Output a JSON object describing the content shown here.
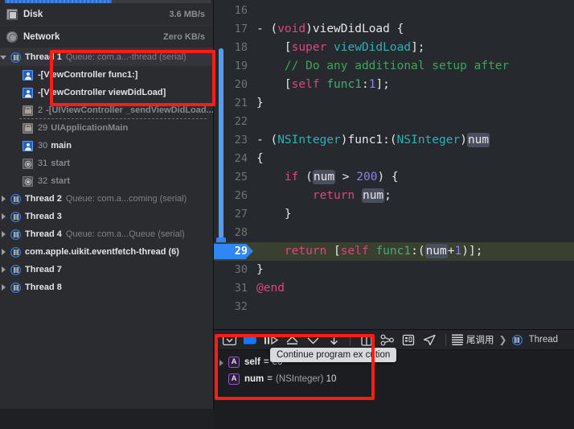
{
  "navigator": {
    "gauges": [
      {
        "icon": "disk-icon",
        "label": "Disk",
        "value": "3.6 MB/s"
      },
      {
        "icon": "network-icon",
        "label": "Network",
        "value": "Zero KB/s"
      }
    ],
    "threads": [
      {
        "icon": "thread-icon",
        "name": "Thread 1",
        "queue": "Queue: com.a...-thread (serial)",
        "expanded": true,
        "selected": true,
        "frames": [
          {
            "icon": "person-icon",
            "num": "",
            "text": "-[ViewController func1:]",
            "style": "bold"
          },
          {
            "icon": "person-icon",
            "num": "",
            "text": "-[ViewController viewDidLoad]",
            "style": "bold"
          },
          {
            "icon": "case-icon",
            "num": "2",
            "text": "-[UIViewController _sendViewDidLoad...",
            "style": "dim"
          },
          {
            "icon": "case-icon",
            "num": "29",
            "text": "UIApplicationMain",
            "style": "dim"
          },
          {
            "icon": "person-icon",
            "num": "30",
            "text": "main",
            "style": "bold"
          },
          {
            "icon": "gear-icon",
            "num": "31",
            "text": "start",
            "style": "dim"
          },
          {
            "icon": "gear-icon",
            "num": "32",
            "text": "start",
            "style": "dim"
          }
        ]
      },
      {
        "icon": "thread-icon",
        "name": "Thread 2",
        "queue": "Queue: com.a...coming (serial)",
        "expanded": false,
        "frames": []
      },
      {
        "icon": "thread-icon",
        "name": "Thread 3",
        "queue": "",
        "expanded": false,
        "frames": []
      },
      {
        "icon": "thread-icon",
        "name": "Thread 4",
        "queue": "Queue: com.a...Queue (serial)",
        "expanded": false,
        "frames": []
      },
      {
        "icon": "thread-icon",
        "name": "com.apple.uikit.eventfetch-thread (6)",
        "queue": "",
        "expanded": false,
        "frames": []
      },
      {
        "icon": "thread-icon",
        "name": "Thread 7",
        "queue": "",
        "expanded": false,
        "frames": []
      },
      {
        "icon": "thread-icon",
        "name": "Thread 8",
        "queue": "",
        "expanded": false,
        "frames": []
      }
    ]
  },
  "editor": {
    "first_line": 16,
    "current_line": 29,
    "lines": [
      {
        "n": "16",
        "tokens": []
      },
      {
        "n": "17",
        "tokens": [
          {
            "t": "- ",
            "c": "plain"
          },
          {
            "t": "(",
            "c": "plain"
          },
          {
            "t": "void",
            "c": "kw"
          },
          {
            "t": ")",
            "c": "plain"
          },
          {
            "t": "viewDidLoad",
            "c": "plain"
          },
          {
            "t": " {",
            "c": "plain"
          }
        ]
      },
      {
        "n": "18",
        "tokens": [
          {
            "t": "    [",
            "c": "plain"
          },
          {
            "t": "super",
            "c": "kw"
          },
          {
            "t": " ",
            "c": "plain"
          },
          {
            "t": "viewDidLoad",
            "c": "type"
          },
          {
            "t": "];",
            "c": "plain"
          }
        ]
      },
      {
        "n": "19",
        "tokens": [
          {
            "t": "    // Do any additional setup after",
            "c": "cmt"
          }
        ]
      },
      {
        "n": "20",
        "tokens": [
          {
            "t": "    [",
            "c": "plain"
          },
          {
            "t": "self",
            "c": "kw"
          },
          {
            "t": " ",
            "c": "plain"
          },
          {
            "t": "func1",
            "c": "fn"
          },
          {
            "t": ":",
            "c": "plain"
          },
          {
            "t": "1",
            "c": "num"
          },
          {
            "t": "];",
            "c": "plain"
          }
        ]
      },
      {
        "n": "21",
        "tokens": [
          {
            "t": "}",
            "c": "plain"
          }
        ]
      },
      {
        "n": "22",
        "tokens": []
      },
      {
        "n": "23",
        "tokens": [
          {
            "t": "- ",
            "c": "plain"
          },
          {
            "t": "(",
            "c": "plain"
          },
          {
            "t": "NSInteger",
            "c": "type"
          },
          {
            "t": ")",
            "c": "plain"
          },
          {
            "t": "func1",
            "c": "plain"
          },
          {
            "t": ":(",
            "c": "plain"
          },
          {
            "t": "NSInteger",
            "c": "type"
          },
          {
            "t": ")",
            "c": "plain"
          },
          {
            "t": "num",
            "c": "varhl"
          }
        ]
      },
      {
        "n": "24",
        "tokens": [
          {
            "t": "{",
            "c": "plain"
          }
        ]
      },
      {
        "n": "25",
        "tokens": [
          {
            "t": "    ",
            "c": "plain"
          },
          {
            "t": "if",
            "c": "kw"
          },
          {
            "t": " (",
            "c": "plain"
          },
          {
            "t": "num",
            "c": "varhl"
          },
          {
            "t": " > ",
            "c": "plain"
          },
          {
            "t": "200",
            "c": "num"
          },
          {
            "t": ") {",
            "c": "plain"
          }
        ]
      },
      {
        "n": "26",
        "tokens": [
          {
            "t": "        ",
            "c": "plain"
          },
          {
            "t": "return",
            "c": "kw"
          },
          {
            "t": " ",
            "c": "plain"
          },
          {
            "t": "num",
            "c": "varhl"
          },
          {
            "t": ";",
            "c": "plain"
          }
        ]
      },
      {
        "n": "27",
        "tokens": [
          {
            "t": "    }",
            "c": "plain"
          }
        ]
      },
      {
        "n": "28",
        "tokens": []
      },
      {
        "n": "29",
        "current": true,
        "tokens": [
          {
            "t": "    ",
            "c": "plain"
          },
          {
            "t": "return",
            "c": "kw"
          },
          {
            "t": " [",
            "c": "plain"
          },
          {
            "t": "self",
            "c": "kw"
          },
          {
            "t": " ",
            "c": "plain"
          },
          {
            "t": "func1",
            "c": "fn"
          },
          {
            "t": ":(",
            "c": "plain"
          },
          {
            "t": "num",
            "c": "varhl"
          },
          {
            "t": "+",
            "c": "plain"
          },
          {
            "t": "1",
            "c": "num"
          },
          {
            "t": ")];",
            "c": "plain"
          }
        ]
      },
      {
        "n": "30",
        "tokens": [
          {
            "t": "}",
            "c": "plain"
          }
        ]
      },
      {
        "n": "31",
        "tokens": [
          {
            "t": "@end",
            "c": "kw"
          }
        ]
      },
      {
        "n": "32",
        "tokens": []
      }
    ]
  },
  "debug_bar": {
    "buttons": [
      {
        "name": "hide-debug-area-button",
        "icon": "panel-toggle-icon"
      },
      {
        "name": "continue-button",
        "icon": "continue-icon"
      },
      {
        "name": "step-over-button",
        "icon": "step-over-icon"
      },
      {
        "name": "step-into-button",
        "icon": "step-into-icon"
      },
      {
        "name": "step-out-button",
        "icon": "step-out-icon"
      },
      {
        "name": "step-out-extra-button",
        "icon": "step-out-alt-icon"
      }
    ],
    "right_buttons": [
      {
        "name": "view-debugger-button",
        "icon": "view-hierarchy-icon"
      },
      {
        "name": "memory-graph-button",
        "icon": "memory-graph-icon"
      },
      {
        "name": "debug-view-button",
        "icon": "debug-view-icon"
      },
      {
        "name": "simulate-location-button",
        "icon": "location-arrow-icon"
      }
    ],
    "tail_call_label": "尾调用",
    "chevron": "❯",
    "thread_label": "Thread",
    "tooltip": "Continue program ex cution"
  },
  "variables": [
    {
      "disclosure": true,
      "badge": "A",
      "name": "self",
      "eq": "=",
      "type": "",
      "value": "e0"
    },
    {
      "disclosure": false,
      "badge": "A",
      "name": "num",
      "eq": "=",
      "type": "(NSInteger)",
      "value": "10"
    }
  ]
}
